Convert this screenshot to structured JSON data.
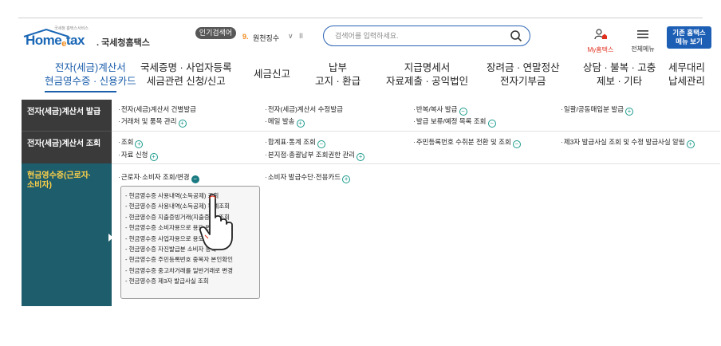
{
  "header": {
    "logo_tagline": "국세청 홈택스서비스",
    "logo_main": "Home",
    "logo_e": "e",
    "logo_tax": "tax",
    "logo_org": ". 국세청홈택스",
    "popular_badge": "인기검색어",
    "popular_rank": "9.",
    "popular_term": "원천징수",
    "rank_toggle": "∨",
    "rank_pause": "II",
    "search_placeholder": "검색어를 입력하세요.",
    "my_hometax": "My홈택스",
    "all_menu": "전체메뉴",
    "legacy_line1": "기존 홈택스",
    "legacy_line2": "메뉴 보기"
  },
  "nav": [
    {
      "line1": "전자(세금)계산서",
      "line2": "현금영수증 · 신용카드"
    },
    {
      "line1": "국세증명 · 사업자등록",
      "line2": "세금관련 신청/신고"
    },
    {
      "line1": "세금신고",
      "line2": ""
    },
    {
      "line1": "납부",
      "line2": "고지 · 환급"
    },
    {
      "line1": "지급명세서",
      "line2": "자료제출 · 공익법인"
    },
    {
      "line1": "장려금 · 연말정산",
      "line2": "전자기부금"
    },
    {
      "line1": "상담 · 불복 · 고충",
      "line2": "제보 · 기타"
    },
    {
      "line1": "세무대리",
      "line2": "납세관리"
    }
  ],
  "sections": [
    {
      "title": "전자(세금)계산서 발급"
    },
    {
      "title": "전자(세금)계산서 조회"
    },
    {
      "title": "현금영수증(근로자·",
      "title2": "소비자)"
    }
  ],
  "links": {
    "r1": [
      "전자(세금)계산서 건별발급",
      "거래처 및 품목 관리",
      "전자(세금)계산서 수정발급",
      "메일 발송",
      "반복/복사 발급",
      "발급 보류/예정 목록 조회",
      "일괄/공동매입분 발급"
    ],
    "r2": [
      "조회",
      "자료 신청",
      "합계표·통계 조회",
      "본지점·총괄납부 조회권한 관리",
      "주민등록번호 수취분 전환 및 조회",
      "제3자 발급사실 조회 및 수정 발급사실 알림"
    ],
    "r3": [
      "근로자·소비자 조회/변경",
      "소비자 발급수단·전용카드"
    ]
  },
  "submenu": [
    "- 현금영수증 사용내역(소득공제) 조회",
    "- 현금영수증 사용내역(소득공제) 누계조회",
    "- 현금영수증 지출증빙거래(지출증빙) 조회",
    "- 현금영수증 소비자용으로 용도 변경",
    "- 현금영수증 사업자용으로 용도 변경",
    "- 현금영수증 자진발급분 소비자 등록",
    "- 현금영수증 주민등록번호 중복자 본인확인",
    "- 현금영수증 중고차거래를 일반거래로 변경",
    "- 현금영수증 제3자 발급사실 조회"
  ],
  "icons": {
    "plus": "+",
    "minus": "−"
  },
  "colors": {
    "brand_blue": "#1b5eab",
    "accent_orange": "#f08a1c",
    "teal": "#1a9a8c",
    "side_dark": "#3a3a3a",
    "side_teal": "#1e5d6b",
    "active_yellow": "#ffd24a"
  }
}
